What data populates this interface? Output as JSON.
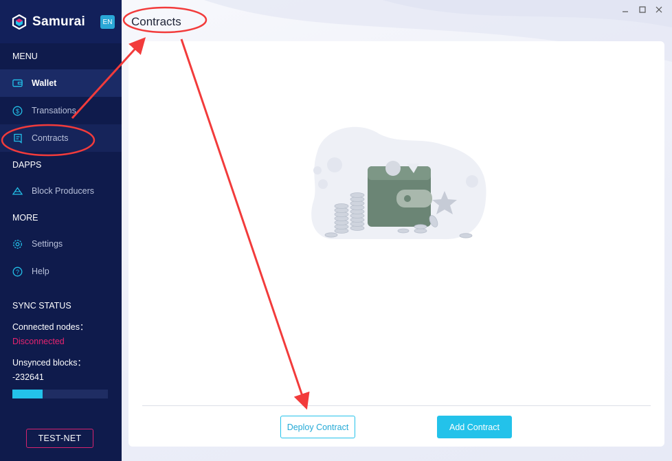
{
  "brand": {
    "name": "Samurai",
    "lang": "EN"
  },
  "sidebar": {
    "menu_title": "MENU",
    "items": [
      {
        "label": "Wallet",
        "icon": "wallet-icon"
      },
      {
        "label": "Transations",
        "icon": "dollar-icon"
      },
      {
        "label": "Contracts",
        "icon": "contract-icon"
      }
    ],
    "dapps_title": "DAPPS",
    "dapps_items": [
      {
        "label": "Block Producers",
        "icon": "cube-icon"
      }
    ],
    "more_title": "MORE",
    "more_items": [
      {
        "label": "Settings",
        "icon": "gear-icon"
      },
      {
        "label": "Help",
        "icon": "help-icon"
      }
    ],
    "sync": {
      "title": "SYNC STATUS",
      "nodes_label": "Connected nodes：",
      "nodes_value": "Disconnected",
      "blocks_label": "Unsynced blocks：",
      "blocks_value": "-232641",
      "progress": 0.32
    },
    "network": "TEST-NET"
  },
  "main": {
    "title": "Contracts",
    "deploy_label": "Deploy Contract",
    "add_label": "Add Contract"
  },
  "colors": {
    "sidebar": "#0f1b4c",
    "accent": "#23c2ea",
    "danger": "#e7246f"
  }
}
